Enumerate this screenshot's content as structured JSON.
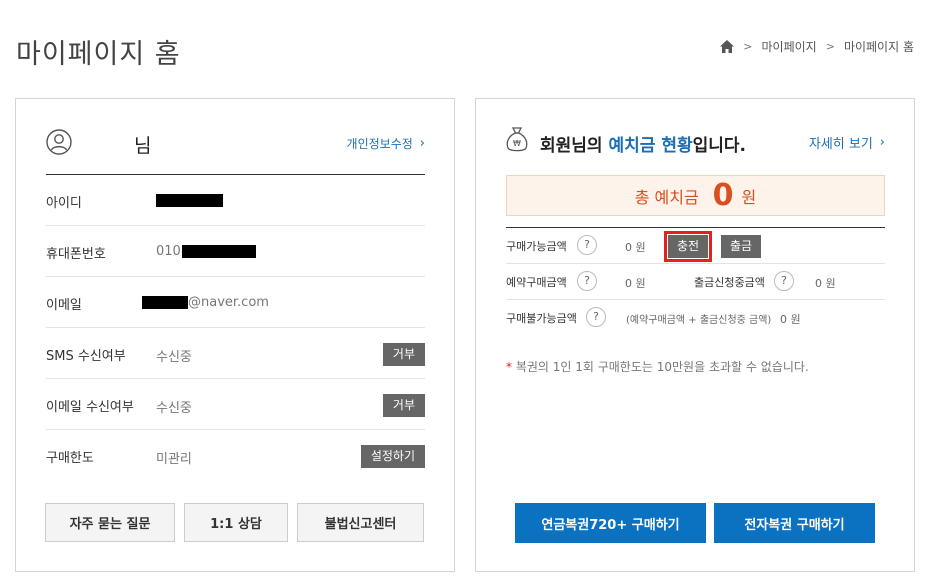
{
  "page": {
    "title": "마이페이지 홈",
    "breadcrumb": [
      "마이페이지",
      "마이페이지 홈"
    ]
  },
  "profile": {
    "name_suffix": "님",
    "edit_link": "개인정보수정",
    "rows": [
      {
        "label": "아이디",
        "value": ""
      },
      {
        "label": "휴대폰번호",
        "value": "010"
      },
      {
        "label": "이메일",
        "value": "@naver.com"
      },
      {
        "label": "SMS 수신여부",
        "value": "수신중",
        "button": "거부"
      },
      {
        "label": "이메일 수신여부",
        "value": "수신중",
        "button": "거부"
      },
      {
        "label": "구매한도",
        "value": "미관리",
        "button": "설정하기"
      }
    ],
    "bottom_buttons": [
      "자주 묻는 질문",
      "1:1 상담",
      "불법신고센터"
    ]
  },
  "deposit": {
    "title_prefix": "회원님의 ",
    "title_highlight": "예치금 현황",
    "title_suffix": "입니다.",
    "detail_link": "자세히 보기",
    "total_label": "총 예치금",
    "total_amount": "0",
    "total_unit": "원",
    "rows": {
      "available_label": "구매가능금액",
      "available_value": "0 원",
      "charge_button": "충전",
      "withdraw_button": "출금",
      "reserved_label": "예약구매금액",
      "reserved_value": "0 원",
      "withdraw_request_label": "출금신청중금액",
      "withdraw_request_value": "0 원",
      "unavailable_label": "구매불가능금액",
      "unavailable_detail": "(예약구매금액 + 출금신청중 금액)",
      "unavailable_value": "0 원",
      "help_glyph": "?"
    },
    "notice_star": "*",
    "notice": " 복권의 1인 1회 구매한도는 10만원을 초과할 수 없습니다.",
    "buy_buttons": [
      "연금복권720+ 구매하기",
      "전자복권 구매하기"
    ]
  },
  "colors": {
    "accent_blue": "#0b72c1",
    "link_blue": "#1a6eb5",
    "deposit_orange": "#d9501f",
    "highlight_red": "#e0231e"
  }
}
